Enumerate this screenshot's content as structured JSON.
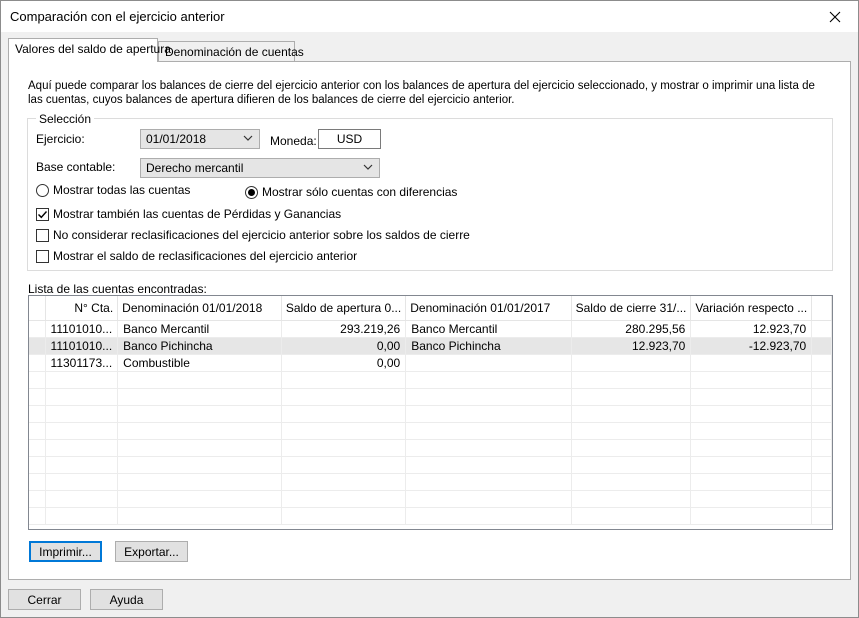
{
  "window": {
    "title": "Comparación con el ejercicio anterior"
  },
  "tabs": [
    {
      "label": "Valores del saldo de apertura",
      "active": true
    },
    {
      "label": "Denominación de cuentas",
      "active": false
    }
  ],
  "intro": "Aquí puede comparar los balances de cierre del ejercicio anterior con los balances de apertura del ejercicio seleccionado, y mostrar o imprimir una lista de las cuentas, cuyos balances de apertura difieren de los balances de cierre del ejercicio anterior.",
  "selection": {
    "legend": "Selección",
    "ejercicio_label": "Ejercicio:",
    "ejercicio_value": "01/01/2018",
    "moneda_label": "Moneda:",
    "moneda_value": "USD",
    "base_label": "Base contable:",
    "base_value": "Derecho mercantil",
    "radio_all": "Mostrar todas las cuentas",
    "radio_diff": "Mostrar sólo cuentas con diferencias",
    "check_pyg": "Mostrar también las cuentas de Pérdidas y Ganancias",
    "check_reclass": "No considerar reclasificaciones del ejercicio anterior sobre los saldos de cierre",
    "check_saldo": "Mostrar el saldo de reclasificaciones del ejercicio anterior"
  },
  "grid": {
    "label": "Lista de las cuentas encontradas:",
    "columns": [
      "N° Cta.",
      "Denominación 01/01/2018",
      "Saldo de apertura 0...",
      "Denominación 01/01/2017",
      "Saldo de cierre 31/...",
      "Variación respecto ..."
    ],
    "rows": [
      [
        "11101010...",
        "Banco Mercantil",
        "293.219,26",
        "Banco Mercantil",
        "280.295,56",
        "12.923,70"
      ],
      [
        "11101010...",
        "Banco Pichincha",
        "0,00",
        "Banco Pichincha",
        "12.923,70",
        "-12.923,70"
      ],
      [
        "11301173...",
        "Combustible",
        "0,00",
        "",
        "",
        ""
      ]
    ]
  },
  "buttons": {
    "print": "Imprimir...",
    "export": "Exportar...",
    "close": "Cerrar",
    "help": "Ayuda"
  }
}
